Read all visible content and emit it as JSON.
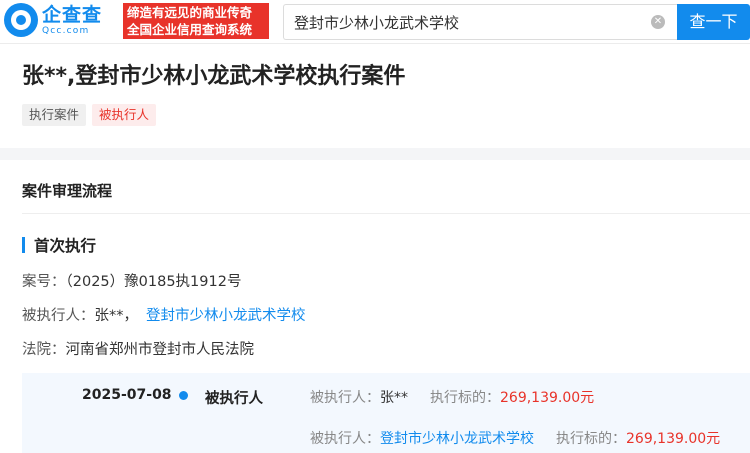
{
  "header": {
    "logo_cn": "企查查",
    "logo_en": "Qcc.com",
    "slogan_line1": "缔造有远见的商业传奇",
    "slogan_line2": "全国企业信用查询系统",
    "search_value": "登封市少林小龙武术学校",
    "clear_glyph": "✕",
    "search_button": "查一下"
  },
  "title": {
    "text": "张**,登封市少林小龙武术学校执行案件",
    "tags": [
      "执行案件",
      "被执行人"
    ]
  },
  "section": {
    "title": "案件审理流程",
    "subsection": "首次执行"
  },
  "info": {
    "case_label": "案号：",
    "case_value": "（2025）豫0185执1912号",
    "executed_label": "被执行人：",
    "executed_person": "张**，",
    "executed_company": "登封市少林小龙武术学校",
    "court_label": "法院：",
    "court_value": "河南省郑州市登封市人民法院"
  },
  "timeline": {
    "date": "2025-07-08",
    "role": "被执行人",
    "rows": [
      {
        "label": "被执行人：",
        "name": "张**",
        "name_is_link": false,
        "amount_label": "执行标的：",
        "amount": "269,139.00元"
      },
      {
        "label": "被执行人：",
        "name": "登封市少林小龙武术学校",
        "name_is_link": true,
        "amount_label": "执行标的：",
        "amount": "269,139.00元"
      }
    ]
  },
  "colors": {
    "brand": "#128bed",
    "accent_red": "#e8332a"
  }
}
